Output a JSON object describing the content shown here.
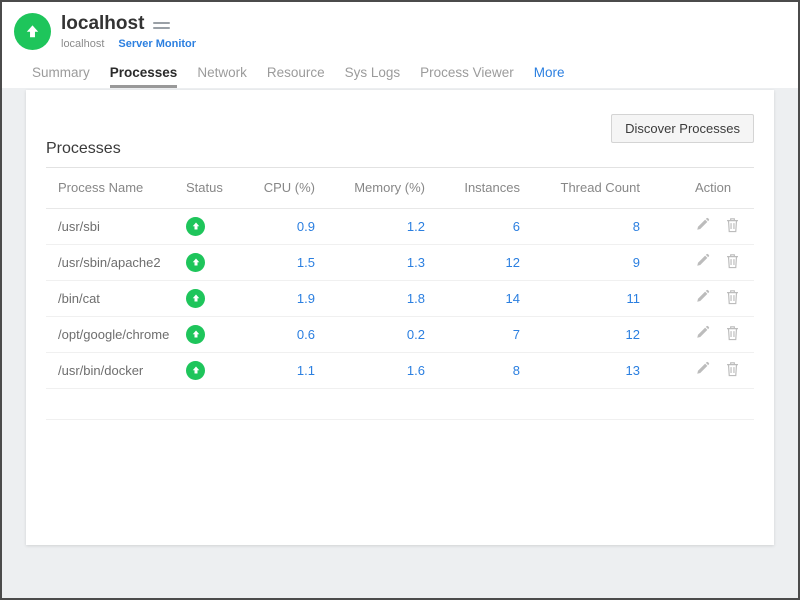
{
  "header": {
    "title": "localhost",
    "breadcrumb": {
      "monitor_name": "localhost",
      "monitor_type": "Server Monitor"
    },
    "icons": {
      "badge": "up-arrow-circle-icon",
      "menu": "hamburger-menu-icon"
    }
  },
  "tabs": {
    "items": [
      {
        "label": "Summary",
        "active": false
      },
      {
        "label": "Processes",
        "active": true
      },
      {
        "label": "Network",
        "active": false
      },
      {
        "label": "Resource",
        "active": false
      },
      {
        "label": "Sys Logs",
        "active": false
      },
      {
        "label": "Process Viewer",
        "active": false
      }
    ],
    "more_label": "More"
  },
  "content": {
    "discover_button_label": "Discover Processes",
    "section_title": "Processes",
    "table": {
      "columns": [
        "Process Name",
        "Status",
        "CPU (%)",
        "Memory (%)",
        "Instances",
        "Thread Count",
        "Action"
      ],
      "row_icons": {
        "status": "up-arrow-circle-icon",
        "edit": "pencil-icon",
        "delete": "trash-icon"
      },
      "rows": [
        {
          "name": "/usr/sbi",
          "cpu": "0.9",
          "memory": "1.2",
          "instances": "6",
          "threads": "8"
        },
        {
          "name": "/usr/sbin/apache2",
          "cpu": "1.5",
          "memory": "1.3",
          "instances": "12",
          "threads": "9"
        },
        {
          "name": "/bin/cat",
          "cpu": "1.9",
          "memory": "1.8",
          "instances": "14",
          "threads": "11"
        },
        {
          "name": "/opt/google/chrome",
          "cpu": "0.6",
          "memory": "0.2",
          "instances": "7",
          "threads": "12"
        },
        {
          "name": "/usr/bin/docker",
          "cpu": "1.1",
          "memory": "1.6",
          "instances": "8",
          "threads": "13"
        }
      ]
    }
  },
  "colors": {
    "status_green": "#1ec55b",
    "link_blue": "#2b7fe0",
    "tab_active_underline": "#999999",
    "page_background": "#edeff1"
  }
}
